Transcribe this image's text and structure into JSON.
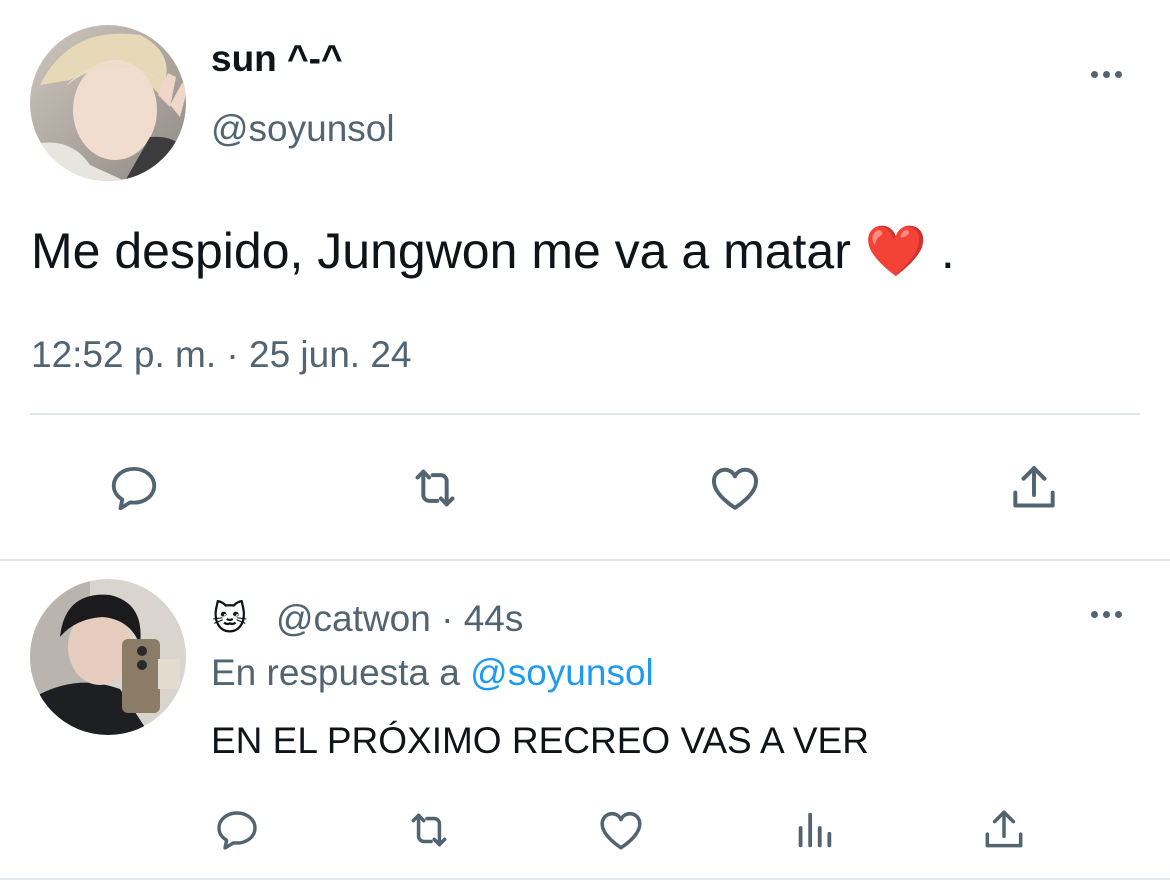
{
  "main_tweet": {
    "display_name": "sun ^-^",
    "handle": "@soyunsol",
    "text": "Me despido, Jungwon me va a matar ❤️ .",
    "timestamp": "12:52 p. m. · 25 jun. 24"
  },
  "reply": {
    "display_emoji": "🐱",
    "handle": "@catwon",
    "separator": "·",
    "time": "44s",
    "reply_prefix": "En respuesta a",
    "reply_to": "@soyunsol",
    "text": "EN EL PRÓXIMO RECREO VAS A VER"
  },
  "colors": {
    "text": "#0f1419",
    "secondary": "#536471",
    "link": "#1d9bf0",
    "divider": "#e1e6ea",
    "heart": "#e0245e"
  },
  "icons": [
    "more-icon",
    "reply-icon",
    "retweet-icon",
    "like-icon",
    "share-icon",
    "analytics-icon"
  ]
}
